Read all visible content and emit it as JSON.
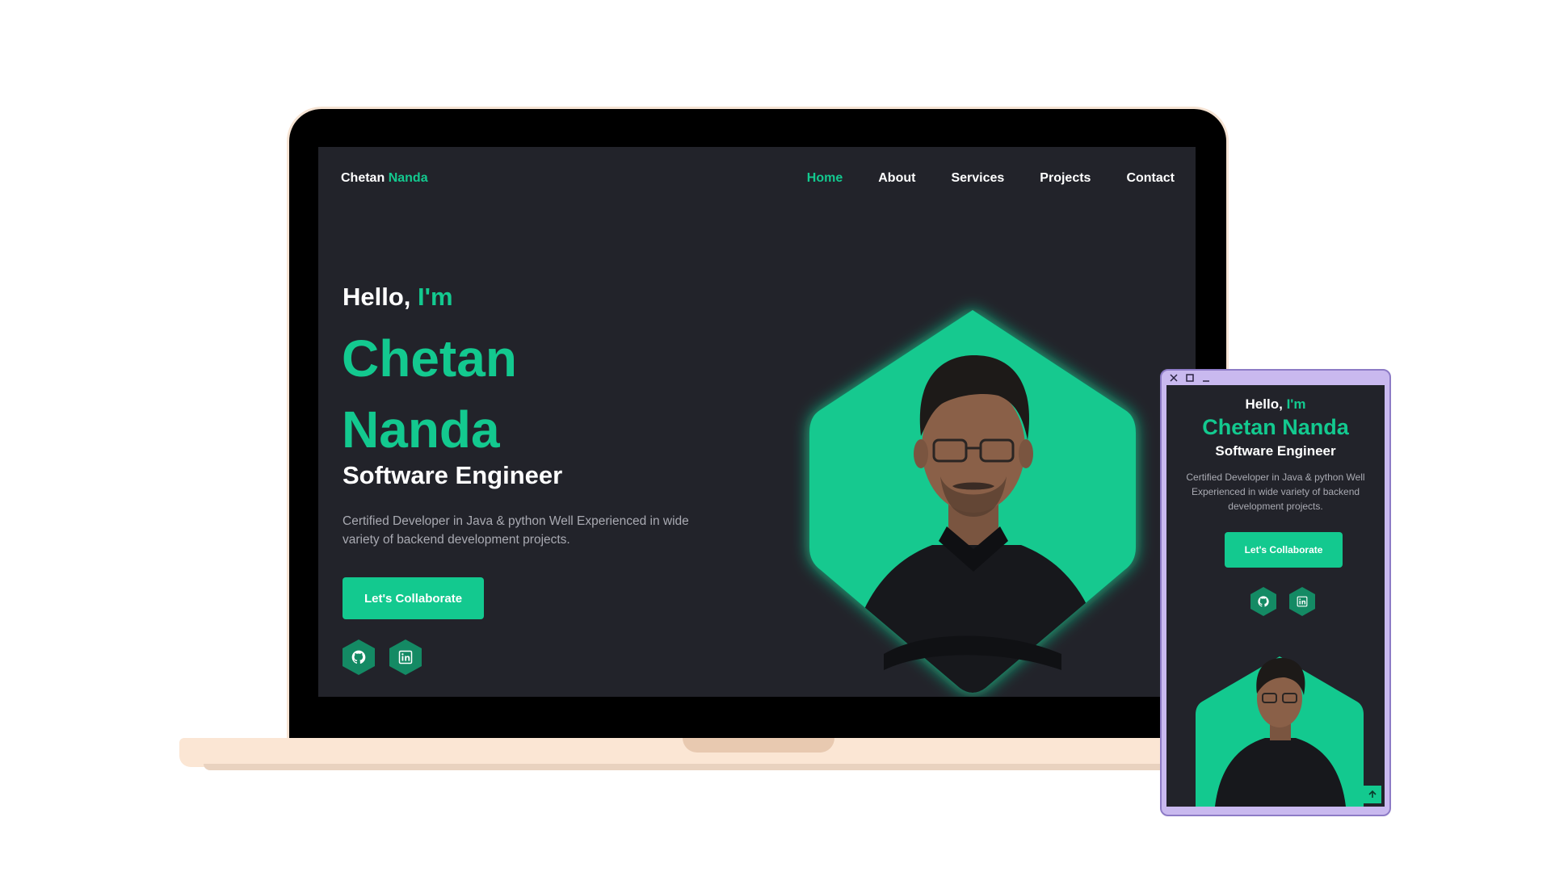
{
  "navbar": {
    "logo_first": "Chetan",
    "logo_second": "Nanda",
    "links": [
      "Home",
      "About",
      "Services",
      "Projects",
      "Contact"
    ]
  },
  "hero": {
    "hello": "Hello,",
    "im": "I'm",
    "name_line1": "Chetan",
    "name_line2": "Nanda",
    "role": "Software Engineer",
    "description": "Certified Developer in Java & python Well Experienced in wide variety of backend development projects.",
    "cta_label": "Let's Collaborate"
  },
  "mobile": {
    "hello": "Hello,",
    "im": "I'm",
    "name": "Chetan Nanda",
    "role": "Software Engineer",
    "description": "Certified Developer in Java & python Well Experienced in wide variety of backend development projects.",
    "cta_label": "Let's Collaborate"
  },
  "icons": {
    "social": [
      "github-icon",
      "linkedin-icon"
    ],
    "window_controls": [
      "close-icon",
      "maximize-icon",
      "minimize-icon"
    ],
    "scroll": "arrow-up-icon"
  },
  "colors": {
    "accent": "#13c98f",
    "background": "#22232a",
    "text": "#ffffff",
    "muted": "#a9aab2",
    "laptop_base": "#fbe6d4",
    "window_frame": "#c9b9ef"
  }
}
